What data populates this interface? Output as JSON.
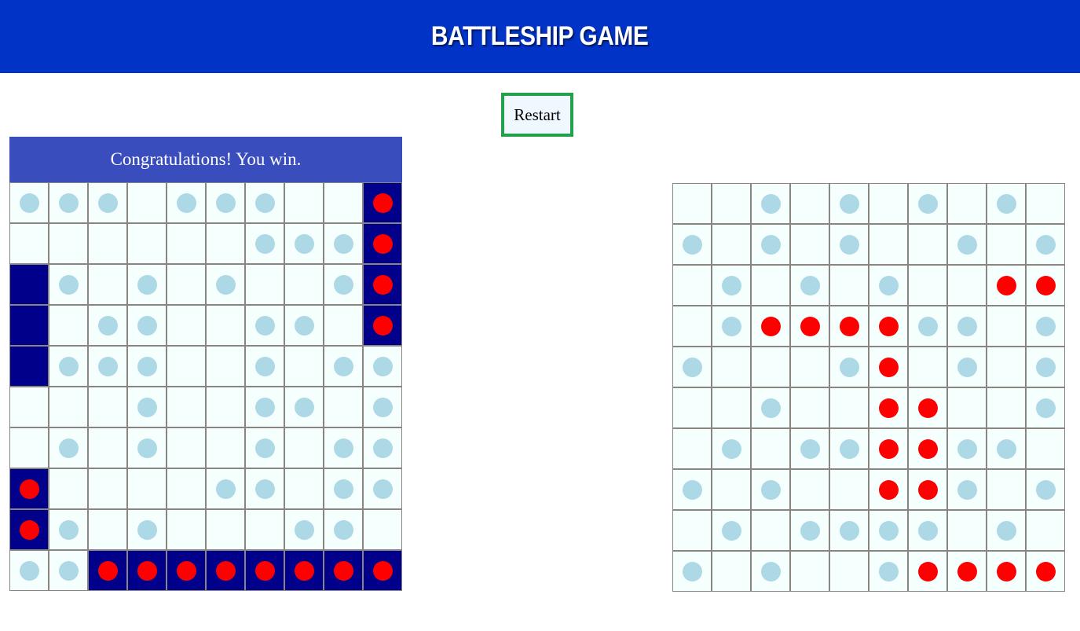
{
  "header": {
    "title": "BATTLESHIP GAME"
  },
  "controls": {
    "restart_label": "Restart"
  },
  "status": {
    "message": "Congratulations! You win."
  },
  "legend": {
    "empty": ".",
    "miss": "o",
    "hit": "x",
    "ship": "S"
  },
  "colors": {
    "header_bg": "#0033c6",
    "message_bg": "#3a4dbc",
    "ship": "#00008b",
    "hit": "#ff0000",
    "miss": "#add8e6",
    "water": "#f5fffe",
    "restart_border": "#22a04a"
  },
  "player_board": [
    "ooo.ooo..x",
    "......ooox",
    "So.o.o..ox",
    "S.oo..oo.x",
    "Sooo..o.oo",
    "...o..oo.o",
    ".o.o..o.oo",
    "x....oo.oo",
    "xo.o...oo.",
    "ooxxxxxxxx"
  ],
  "enemy_board": [
    "..o.o.o.o.",
    "o.o.o..o.o",
    ".o.o.o..xx",
    ".oxxxxoo.o",
    "o...ox.o.o",
    "..o..xx..o",
    ".o.ooxxoo.",
    "o.o..xxo.o",
    ".o.oooo.o.",
    "o.o..oxxxx"
  ]
}
